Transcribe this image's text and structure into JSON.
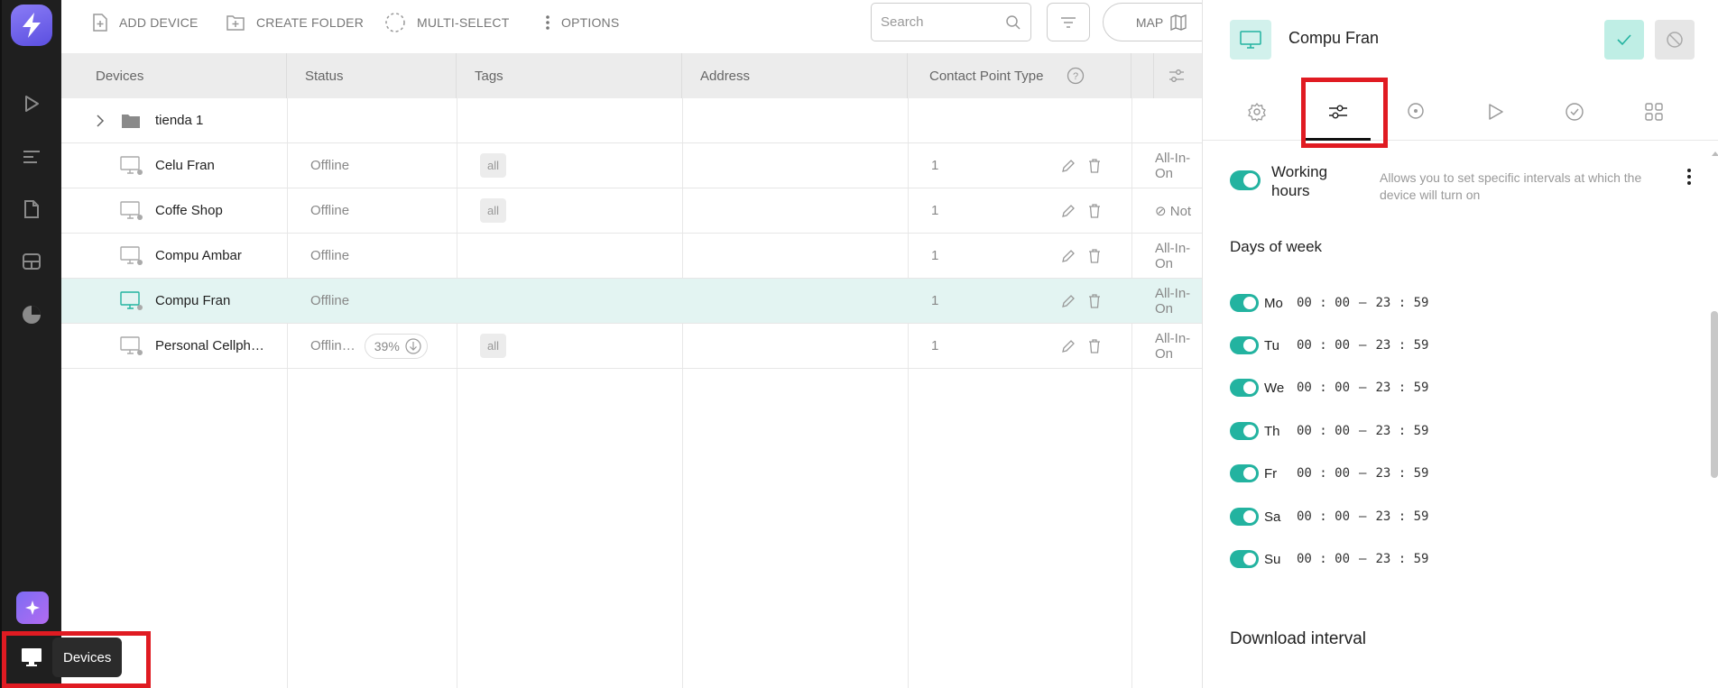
{
  "rail": {
    "items": [
      "lightning-logo",
      "play-icon",
      "sliders-icon",
      "document-icon",
      "layout-icon",
      "pie-chart-icon"
    ],
    "tooltip": "Devices"
  },
  "toolbar": {
    "add_device": "ADD DEVICE",
    "create_folder": "CREATE FOLDER",
    "multi_select": "MULTI-SELECT",
    "options": "OPTIONS",
    "search_placeholder": "Search",
    "map": "MAP"
  },
  "table": {
    "headers": [
      "Devices",
      "Status",
      "Tags",
      "Address",
      "Contact Point Type"
    ],
    "folder": "tienda 1",
    "rows": [
      {
        "name": "Celu Fran",
        "status": "Offline",
        "tag": "all",
        "cpt": "1",
        "extra": "All-In-On"
      },
      {
        "name": "Coffe Shop",
        "status": "Offline",
        "tag": "all",
        "cpt": "1",
        "extra": "⊘ Not"
      },
      {
        "name": "Compu Ambar",
        "status": "Offline",
        "tag": "",
        "cpt": "1",
        "extra": "All-In-On"
      },
      {
        "name": "Compu Fran",
        "status": "Offline",
        "tag": "",
        "cpt": "1",
        "extra": "All-In-On"
      },
      {
        "name": "Personal Cellph…",
        "status": "Offlin…",
        "tag": "all",
        "cpt": "1",
        "extra": "All-In-On",
        "progress": "39%"
      }
    ]
  },
  "panel": {
    "title": "Compu Fran",
    "working_hours": {
      "title": "Working hours",
      "description": "Allows you to set specific intervals at which the device will turn on"
    },
    "days_title": "Days of week",
    "days": [
      {
        "name": "Mo",
        "from": "00 : 00",
        "to": "23 : 59"
      },
      {
        "name": "Tu",
        "from": "00 : 00",
        "to": "23 : 59"
      },
      {
        "name": "We",
        "from": "00 : 00",
        "to": "23 : 59"
      },
      {
        "name": "Th",
        "from": "00 : 00",
        "to": "23 : 59"
      },
      {
        "name": "Fr",
        "from": "00 : 00",
        "to": "23 : 59"
      },
      {
        "name": "Sa",
        "from": "00 : 00",
        "to": "23 : 59"
      },
      {
        "name": "Su",
        "from": "00 : 00",
        "to": "23 : 59"
      }
    ],
    "download_title": "Download interval"
  },
  "colors": {
    "accent": "#23b3a0",
    "highlight": "#e01b22",
    "selected_row": "#e3f4f2"
  }
}
